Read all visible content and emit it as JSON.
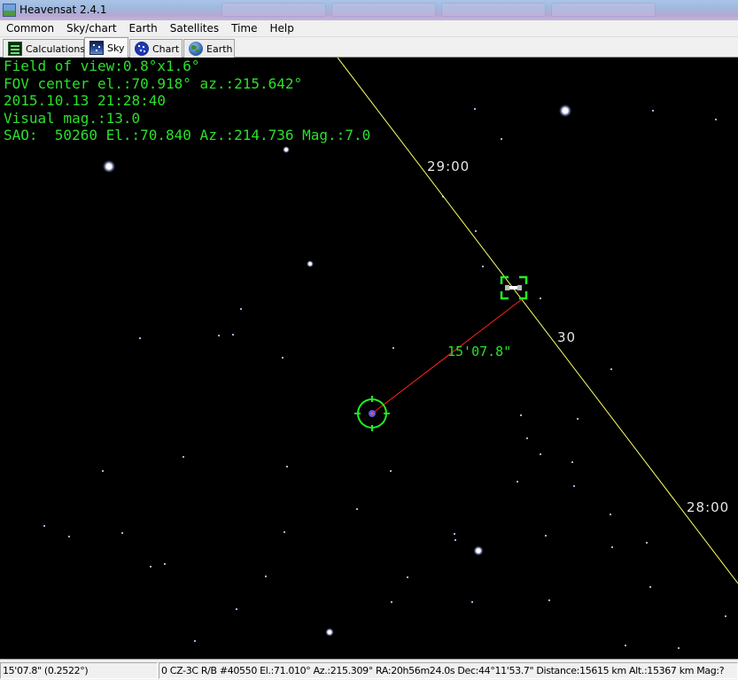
{
  "window": {
    "title": "Heavensat 2.4.1",
    "icon": "app-icon"
  },
  "menu": [
    "Common",
    "Sky/chart",
    "Earth",
    "Satellites",
    "Time",
    "Help"
  ],
  "tabs": [
    {
      "label": "Calculations",
      "icon": "calculations-icon",
      "active": false
    },
    {
      "label": "Sky",
      "icon": "sky-icon",
      "active": true
    },
    {
      "label": "Chart",
      "icon": "chart-icon",
      "active": false
    },
    {
      "label": "Earth",
      "icon": "earth-icon",
      "active": false
    }
  ],
  "sky": {
    "info": [
      "Field of view:0.8°x1.6°",
      "FOV center el.:70.918° az.:215.642°",
      "2015.10.13 21:28:40",
      "Visual mag.:13.0",
      "SAO:  50260 El.:70.840 Az.:214.736 Mag.:7.0"
    ],
    "track_labels": [
      "29:00",
      "30",
      "28:00"
    ],
    "distance_label": "15'07.8\"",
    "colors": {
      "background": "#000000",
      "info_text": "#2be02b",
      "track_line": "#ffff66",
      "distance_line": "#ff2020",
      "marker": "#22ee22"
    },
    "markers": [
      "satellite-target-marker",
      "star-target-marker"
    ]
  },
  "status": {
    "left": "15'07.8\" (0.2522°)",
    "right": "0 CZ-3C R/B #40550 El.:71.010°  Az.:215.309° RA:20h56m24.0s Dec:44°11'53.7\" Distance:15615 km  Alt.:15367 km  Mag:?"
  }
}
